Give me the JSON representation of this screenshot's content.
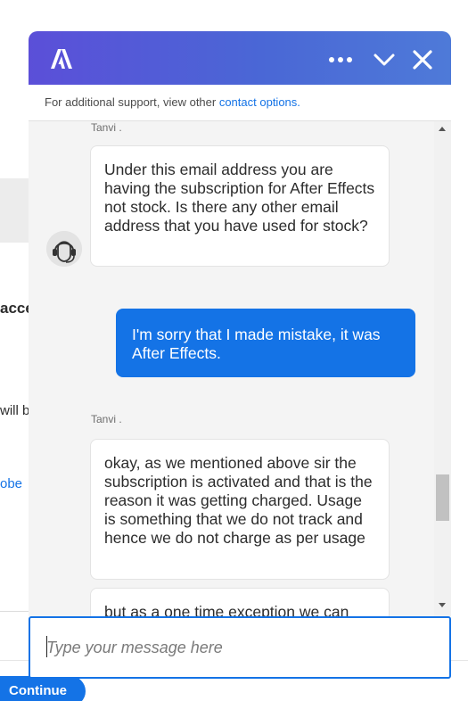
{
  "background_page": {
    "fragment_1": "acce",
    "fragment_2": "will b",
    "fragment_3": "obe",
    "continue_label": "Continue"
  },
  "chat": {
    "support_text": "For additional support, view other ",
    "support_link": "contact options.",
    "input_placeholder": "Type your message here",
    "messages": [
      {
        "sender": "Tanvi .",
        "text": "Under this email address you are having the subscription for After Effects not stock. Is there any other email address that you have used for stock?"
      },
      {
        "sender": "user",
        "text": "I'm sorry that I made mistake, it was After Effects."
      },
      {
        "sender": "Tanvi .",
        "text": "okay, as we mentioned above sir the subscription is activated and that is the reason it was getting charged. Usage is something that we do not track and hence we do not charge as per usage"
      },
      {
        "sender": "Tanvi .",
        "text": "but as a one time exception we can"
      }
    ]
  },
  "colors": {
    "accent": "#1473e6",
    "header_gradient_start": "#5b4fd8",
    "header_gradient_end": "#4e7ad8"
  },
  "icons": [
    "adobe-logo-icon",
    "more-options-icon",
    "chevron-down-icon",
    "close-icon",
    "agent-headset-icon"
  ]
}
